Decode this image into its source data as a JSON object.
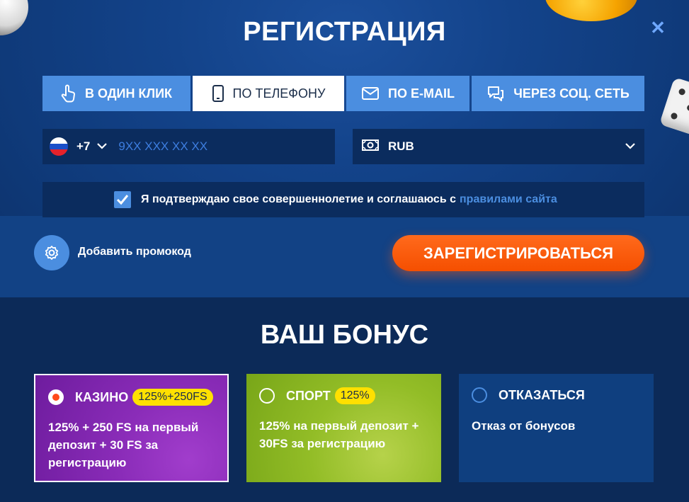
{
  "header": {
    "title": "РЕГИСТРАЦИЯ",
    "close_label": "✕"
  },
  "tabs": [
    {
      "label": "В ОДИН КЛИК",
      "icon": "hand-pointer-icon",
      "active": false
    },
    {
      "label": "ПО ТЕЛЕФОНУ",
      "icon": "phone-icon",
      "active": true
    },
    {
      "label": "ПО E-MAIL",
      "icon": "envelope-icon",
      "active": false
    },
    {
      "label": "ЧЕРЕЗ СОЦ. СЕТЬ",
      "icon": "chat-bubbles-icon",
      "active": false
    }
  ],
  "phone": {
    "country_code": "+7",
    "flag": "russia-flag-icon",
    "placeholder": "9XX XXX XX XX",
    "value": ""
  },
  "currency": {
    "value": "RUB",
    "icon": "money-icon"
  },
  "agreement": {
    "checked": true,
    "text": "Я подтверждаю свое совершеннолетие и соглашаюсь с",
    "link_text": "правилами сайта"
  },
  "promo": {
    "label": "Добавить промокод",
    "icon": "gear-icon"
  },
  "register_button": {
    "label": "ЗАРЕГИСТРИРОВАТЬСЯ"
  },
  "bonus": {
    "title": "ВАШ БОНУС",
    "options": [
      {
        "name": "КАЗИНО",
        "badge": "125%+250FS",
        "description": "125% + 250 FS на первый депозит + 30 FS за регистрацию",
        "selected": true
      },
      {
        "name": "СПОРТ",
        "badge": "125%",
        "description": "125% на первый депозит + 30FS за регистрацию",
        "selected": false
      },
      {
        "name": "ОТКАЗАТЬСЯ",
        "badge": "",
        "description": "Отказ от бонусов",
        "selected": false
      }
    ]
  },
  "colors": {
    "accent_blue": "#4b8ee0",
    "register_orange": "#f54f00",
    "badge_yellow": "#ffe000",
    "casino_purple": "#8a2cb8",
    "sport_green": "#93bd27"
  }
}
